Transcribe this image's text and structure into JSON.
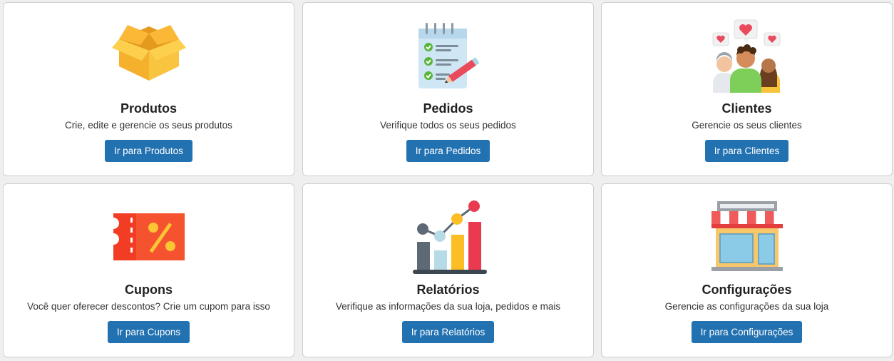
{
  "cards": [
    {
      "title": "Produtos",
      "description": "Crie, edite e gerencie os seus produtos",
      "button": "Ir para Produtos",
      "icon": "box-icon"
    },
    {
      "title": "Pedidos",
      "description": "Verifique todos os seus pedidos",
      "button": "Ir para Pedidos",
      "icon": "clipboard-checklist-icon"
    },
    {
      "title": "Clientes",
      "description": "Gerencie os seus clientes",
      "button": "Ir para Clientes",
      "icon": "customers-icon"
    },
    {
      "title": "Cupons",
      "description": "Você quer oferecer descontos? Crie um cupom para isso",
      "button": "Ir para Cupons",
      "icon": "coupon-icon"
    },
    {
      "title": "Relatórios",
      "description": "Verifique as informações da sua loja, pedidos e mais",
      "button": "Ir para Relatórios",
      "icon": "chart-icon"
    },
    {
      "title": "Configurações",
      "description": "Gerencie as configurações da sua loja",
      "button": "Ir para Configurações",
      "icon": "storefront-icon"
    }
  ],
  "colors": {
    "button": "#2271b1",
    "card_bg": "#ffffff",
    "page_bg": "#efefef"
  }
}
